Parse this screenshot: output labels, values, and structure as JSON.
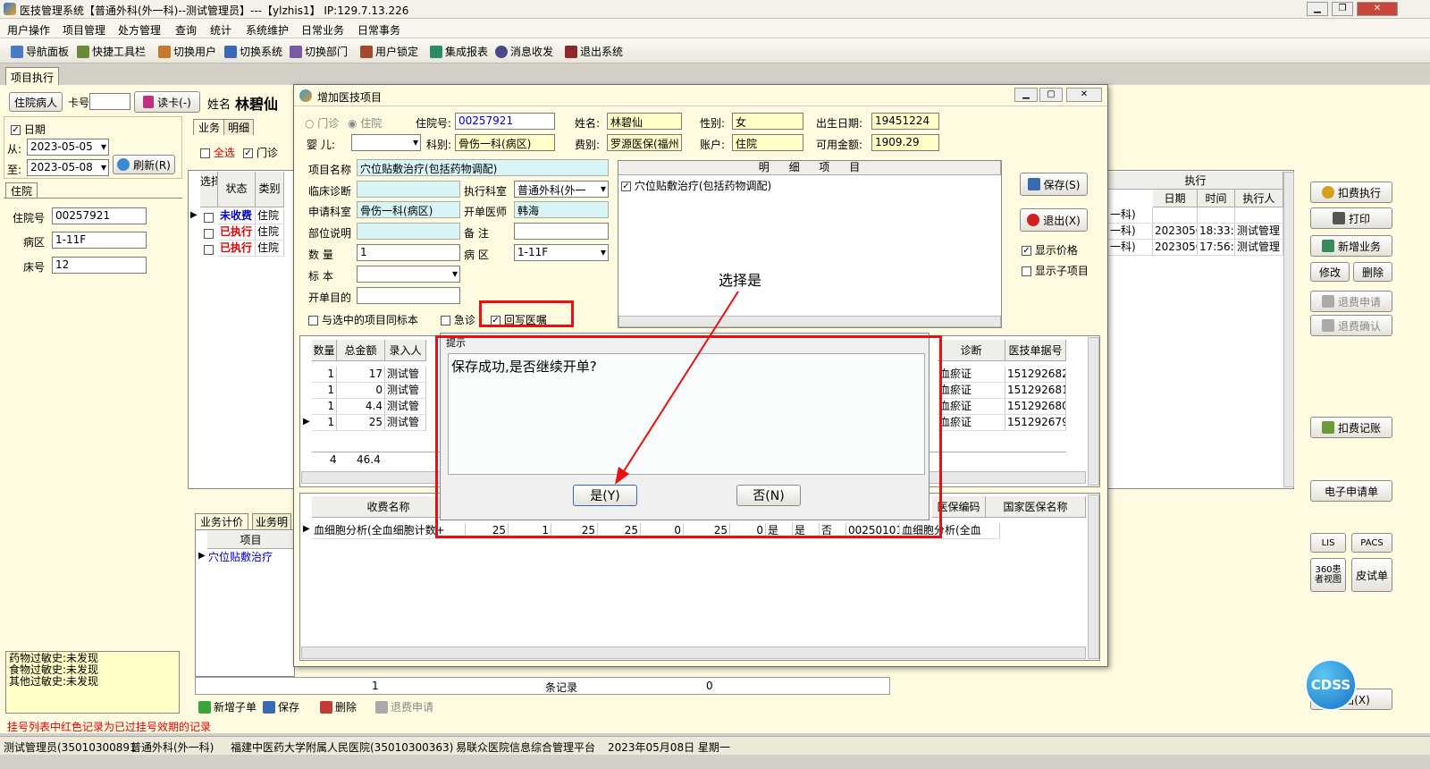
{
  "window": {
    "title": "医技管理系统【普通外科(外一科)--测试管理员】---【ylzhis1】 IP:129.7.13.226"
  },
  "menu": [
    "用户操作",
    "项目管理",
    "处方管理",
    "查询",
    "统计",
    "系统维护",
    "日常业务",
    "日常事务"
  ],
  "toolbar": [
    "导航面板",
    "快捷工具栏",
    "切换用户",
    "切换系统",
    "切换部门",
    "用户锁定",
    "集成报表",
    "消息收发",
    "退出系统"
  ],
  "doc_tab": "项目执行",
  "patient": {
    "type": "住院病人",
    "card_label": "卡号",
    "read_card": "读卡(-)",
    "name_label": "姓名",
    "name": "林碧仙",
    "date_label": "日期",
    "from_label": "从:",
    "from": "2023-05-05",
    "to_label": "至:",
    "to": "2023-05-08",
    "refresh": "刷新(R)",
    "inpatient_tab": "住院",
    "inpatient_no_label": "住院号",
    "inpatient_no": "00257921",
    "ward_label": "病区",
    "ward": "1-11F",
    "bed_label": "床号",
    "bed": "12"
  },
  "biz_tabs": [
    "业务",
    "明细"
  ],
  "filters": {
    "all": "全选",
    "outpatient": "门诊"
  },
  "left_grid": {
    "headers": [
      "选择",
      "状态",
      "类别"
    ],
    "rows": [
      {
        "status": "未收费",
        "type": "住院",
        "color": "#0000cc"
      },
      {
        "status": "已执行",
        "type": "住院",
        "color": "#e00000"
      },
      {
        "status": "已执行",
        "type": "住院",
        "color": "#e00000"
      }
    ]
  },
  "exec_grid": {
    "group_header": "执行",
    "headers": [
      "日期",
      "时间",
      "执行人"
    ],
    "rows": [
      {
        "c1": "一科)",
        "date": "",
        "time": "",
        "who": ""
      },
      {
        "c1": "一科)",
        "date": "20230505",
        "time": "18:33:",
        "who": "测试管理"
      },
      {
        "c1": "一科)",
        "date": "20230505",
        "time": "17:56:",
        "who": "测试管理"
      }
    ]
  },
  "right_buttons": [
    "扣费执行",
    "打印",
    "新增业务",
    "修改",
    "删除",
    "退费申请",
    "退费确认",
    "扣费记账",
    "电子申请单",
    "LIS",
    "PACS",
    "360患者视图",
    "皮试单",
    "退出(X)"
  ],
  "bottom_tabs": [
    "业务计价",
    "业务明"
  ],
  "bottom_left_grid": {
    "header": "项目",
    "row": "穴位贴敷治疗"
  },
  "allergy": [
    "药物过敏史:未发现",
    "食物过敏史:未发现",
    "其他过敏史:未发现"
  ],
  "footer_summary": {
    "count": "1",
    "label": "条记录",
    "value": "0"
  },
  "bottom_toolbar": [
    "新增子单",
    "保存",
    "删除",
    "退费申请"
  ],
  "hint": "挂号列表中红色记录为已过挂号效期的记录",
  "status_bar": [
    "测试管理员(35010300891",
    "普通外科(外一科)",
    "福建中医药大学附属人民医院(35010300363)",
    "易联众医院信息综合管理平台",
    "2023年05月08日 星期一"
  ],
  "cdss": "CDSS",
  "dialog": {
    "title": "增加医技项目",
    "visit_opts": [
      "门诊",
      "住院"
    ],
    "inpatient_no_label": "住院号:",
    "inpatient_no": "00257921",
    "name_label": "姓名:",
    "name": "林碧仙",
    "sex_label": "性别:",
    "sex": "女",
    "birth_label": "出生日期:",
    "birth": "19451224",
    "baby_label": "婴 儿:",
    "dept_label": "科别:",
    "dept": "骨伤一科(病区)",
    "fee_label": "费别:",
    "fee": "罗源医保(福州",
    "account_label": "账户:",
    "account": "住院",
    "balance_label": "可用金额:",
    "balance": "1909.29",
    "item_label": "项目名称",
    "item": "穴位贴敷治疗(包括药物调配)",
    "clinical_label": "临床诊断",
    "exec_dept_label": "执行科室",
    "exec_dept": "普通外科(外一",
    "apply_dept_label": "申请科室",
    "apply_dept": "骨伤一科(病区)",
    "doctor_label": "开单医师",
    "doctor": "韩海",
    "part_label": "部位说明",
    "remark_label": "备 注",
    "qty_label": "数 量",
    "qty": "1",
    "ward_label": "病 区",
    "ward": "1-11F",
    "sample_label": "标 本",
    "purpose_label": "开单目的",
    "same_sample": "与选中的项目同标本",
    "urgent": "急诊",
    "writeback": "回写医嘱",
    "detail_header": "明 细 项 目",
    "detail_item": "穴位贴敷治疗(包括药物调配)",
    "save": "保存(S)",
    "exit": "退出(X)",
    "show_price": "显示价格",
    "show_sub": "显示子项目",
    "grid_headers": [
      "数量",
      "总金额",
      "录入人",
      "诊断",
      "医技单据号"
    ],
    "grid_rows": [
      {
        "qty": "1",
        "amt": "17",
        "who": "测试管",
        "diag": "血瘀证",
        "no": "151292682"
      },
      {
        "qty": "1",
        "amt": "0",
        "who": "测试管",
        "diag": "血瘀证",
        "no": "151292681"
      },
      {
        "qty": "1",
        "amt": "4.4",
        "who": "测试管",
        "diag": "血瘀证",
        "no": "151292680"
      },
      {
        "qty": "1",
        "amt": "25",
        "who": "测试管",
        "diag": "血瘀证",
        "no": "151292679"
      }
    ],
    "grid_total": {
      "qty": "4",
      "amt": "46.4"
    },
    "fee_headers": [
      "收费名称",
      "医保编码",
      "国家医保名称"
    ],
    "fee_row": [
      "血细胞分析(全血细胞计数+",
      "25",
      "1",
      "25",
      "25",
      "0",
      "25",
      "0",
      "是",
      "是",
      "否",
      "002501010150200",
      "血细胞分析(全血"
    ]
  },
  "msgbox": {
    "title": "提示",
    "message": "保存成功,是否继续开单?",
    "yes": "是(Y)",
    "no": "否(N)"
  },
  "annotation": {
    "text": "选择是",
    "color": "#e81010"
  }
}
